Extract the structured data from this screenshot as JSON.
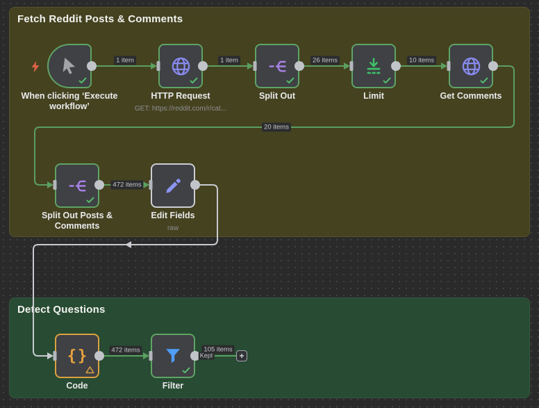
{
  "groups": [
    {
      "title": "Fetch Reddit Posts & Comments",
      "color": "#454220"
    },
    {
      "title": "Detect Questions",
      "color": "#284b33"
    }
  ],
  "nodes": {
    "trigger": {
      "label": "When clicking ‘Execute workflow’",
      "status": "success"
    },
    "http": {
      "label": "HTTP Request",
      "subtitle": "GET: https://reddit.com/r/cat...",
      "status": "success"
    },
    "split_out": {
      "label": "Split Out",
      "status": "success"
    },
    "limit": {
      "label": "Limit",
      "status": "success"
    },
    "get_comments": {
      "label": "Get Comments",
      "status": "success"
    },
    "split_out_posts": {
      "label": "Split Out Posts & Comments",
      "status": "success"
    },
    "edit_fields": {
      "label": "Edit Fields",
      "subtitle": "raw",
      "status": "selected"
    },
    "code": {
      "label": "Code",
      "status": "warning"
    },
    "filter": {
      "label": "Filter",
      "status": "success"
    }
  },
  "connection_labels": {
    "trigger_to_http": "1 item",
    "http_to_split": "1 item",
    "split_to_limit": "26 items",
    "limit_to_comments": "10 items",
    "comments_to_splitposts": "20 items",
    "splitposts_to_edit": "472 items",
    "code_to_filter": "472 items",
    "filter_out": "105 items",
    "filter_output_branch": "Kept"
  },
  "icons": {
    "trigger": "cursor-icon",
    "http": "globe-icon",
    "split_out": "split-items-icon",
    "limit": "limit-icon",
    "get_comments": "globe-icon",
    "edit_fields": "pencil-icon",
    "code_glyph": "{}",
    "filter": "funnel-icon",
    "add_button_glyph": "+"
  },
  "colors": {
    "canvas": "#2a2a2b",
    "node_body": "#3f4145",
    "success_border": "#5fa463",
    "selected_border": "#cdced2",
    "warning_border": "#dba23f",
    "connection_green": "#5b9f60",
    "connection_white": "#c9cbd0",
    "icon_purple": "#a882e6",
    "icon_indigo": "#8789ec",
    "icon_green": "#3fc068",
    "icon_blue": "#4f9df7",
    "icon_orange": "#e8a33d",
    "bolt_red": "#dd6048"
  }
}
